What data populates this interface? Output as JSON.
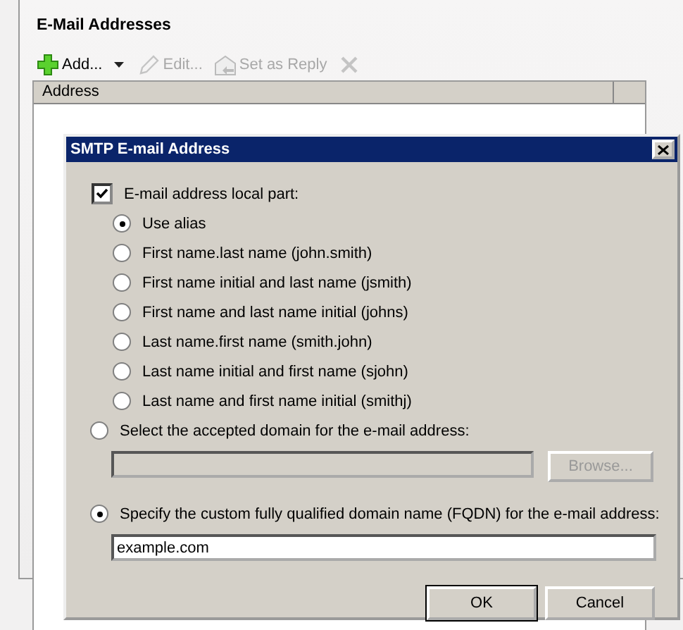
{
  "page": {
    "title": "E-Mail Addresses"
  },
  "toolbar": [
    {
      "kind": "add",
      "label": "Add...",
      "disabled": false,
      "has_menu": true
    },
    {
      "kind": "edit",
      "label": "Edit...",
      "disabled": true,
      "has_menu": false
    },
    {
      "kind": "reply",
      "label": "Set as Reply",
      "disabled": true,
      "has_menu": false
    },
    {
      "kind": "remove",
      "disabled": true,
      "has_menu": false
    }
  ],
  "table": {
    "columns": [
      "Address"
    ]
  },
  "dialog": {
    "title": "SMTP E-mail Address",
    "local_part": {
      "label": "E-mail address local part:",
      "checked": true
    },
    "local_part_options": [
      {
        "label": "Use alias",
        "selected": true
      },
      {
        "label": "First name.last name (john.smith)",
        "selected": false
      },
      {
        "label": "First name initial and last name (jsmith)",
        "selected": false
      },
      {
        "label": "First name and last name initial (johns)",
        "selected": false
      },
      {
        "label": "Last name.first name (smith.john)",
        "selected": false
      },
      {
        "label": "Last name initial and first name (sjohn)",
        "selected": false
      },
      {
        "label": "Last name and first name initial (smithj)",
        "selected": false
      }
    ],
    "accepted_domain": {
      "label": "Select the accepted domain for the e-mail address:",
      "selected": false,
      "disabled": true,
      "browse_label": "Browse..."
    },
    "custom_domain": {
      "label": "Specify the custom fully qualified domain name (FQDN) for the e-mail address:",
      "selected": true,
      "value": "example.com"
    },
    "buttons": [
      {
        "label": "OK",
        "default": true
      },
      {
        "label": "Cancel",
        "default": false
      }
    ]
  }
}
